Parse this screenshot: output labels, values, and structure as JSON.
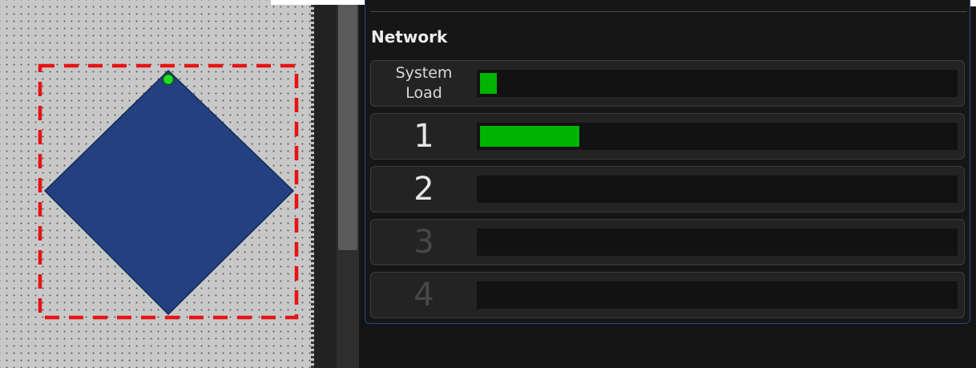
{
  "panel": {
    "title": "Network"
  },
  "rows": [
    {
      "label": "System\nLoad",
      "fill": 0.035
    },
    {
      "label": "1",
      "fill": 0.21
    },
    {
      "label": "2",
      "fill": 0
    },
    {
      "label": "3",
      "fill": 0
    },
    {
      "label": "4",
      "fill": 0
    }
  ],
  "colors": {
    "bar_fill": "#00b400",
    "diamond_fill": "#234080",
    "selection_outline": "#e81414",
    "handle": "#22dd22",
    "panel_border": "#2a4a7c"
  },
  "icons": {
    "handle": "rotate-handle-icon"
  }
}
